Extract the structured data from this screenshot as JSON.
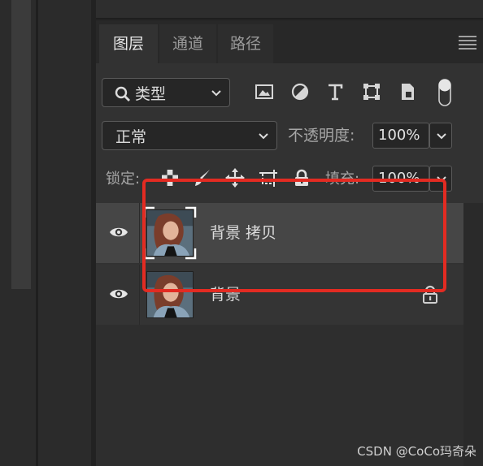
{
  "panel": {
    "tabs": [
      {
        "label": "图层",
        "active": true
      },
      {
        "label": "通道",
        "active": false
      },
      {
        "label": "路径",
        "active": false
      }
    ]
  },
  "filter": {
    "kind_label": "类型",
    "icons": [
      "image-filter-icon",
      "adjustment-filter-icon",
      "type-filter-icon",
      "shape-filter-icon",
      "smart-object-filter-icon",
      "filter-toggle-switch"
    ]
  },
  "blend": {
    "mode": "正常",
    "opacity_label": "不透明度:",
    "opacity_value": "100%"
  },
  "lock": {
    "label": "锁定:",
    "icons": [
      "lock-transparent-icon",
      "lock-image-icon",
      "lock-position-icon",
      "lock-artboard-icon",
      "lock-all-icon"
    ],
    "fill_label": "填充:",
    "fill_value": "100%"
  },
  "layers": [
    {
      "name": "背景 拷贝",
      "visible": true,
      "selected": true,
      "locked": false
    },
    {
      "name": "背景",
      "visible": true,
      "selected": false,
      "locked": true
    }
  ],
  "colors": {
    "highlight": "#e32b22",
    "panel_bg": "#323232",
    "selected_row": "#464646"
  },
  "watermark": "CSDN @CoCo玛奇朵"
}
